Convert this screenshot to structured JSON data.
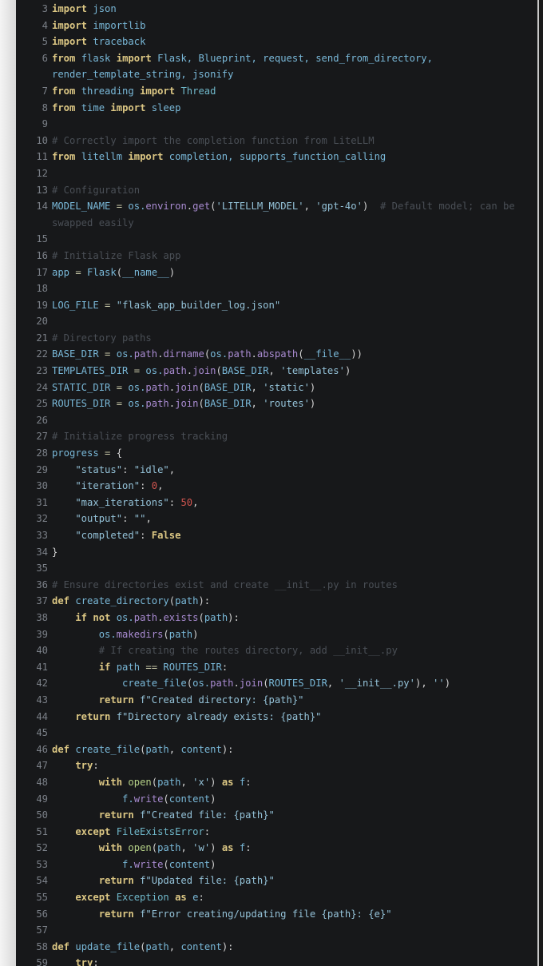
{
  "editor": {
    "language": "python",
    "colors": {
      "background": "#17181a",
      "keyword": "#dcc784",
      "identifier": "#79b8d8",
      "function": "#a98bd1",
      "string": "#94c2d8",
      "number": "#d0554f",
      "comment": "#4a4f56",
      "line_number": "#7b8088"
    },
    "lines": [
      {
        "n": "3",
        "tokens": [
          [
            "kw",
            "import"
          ],
          [
            "id",
            " json"
          ]
        ]
      },
      {
        "n": "4",
        "tokens": [
          [
            "kw",
            "import"
          ],
          [
            "id",
            " importlib"
          ]
        ]
      },
      {
        "n": "5",
        "tokens": [
          [
            "kw",
            "import"
          ],
          [
            "id",
            " traceback"
          ]
        ]
      },
      {
        "n": "6",
        "tokens": [
          [
            "kw",
            "from"
          ],
          [
            "id",
            " flask "
          ],
          [
            "kw",
            "import"
          ],
          [
            "id",
            " Flask, Blueprint, request, send_from_directory,"
          ]
        ]
      },
      {
        "n": "",
        "tokens": [
          [
            "id",
            "render_template_string, jsonify"
          ]
        ]
      },
      {
        "n": "7",
        "tokens": [
          [
            "kw",
            "from"
          ],
          [
            "id",
            " threading "
          ],
          [
            "kw",
            "import"
          ],
          [
            "cls",
            " Thread"
          ]
        ]
      },
      {
        "n": "8",
        "tokens": [
          [
            "kw",
            "from"
          ],
          [
            "id",
            " time "
          ],
          [
            "kw",
            "import"
          ],
          [
            "id",
            " sleep"
          ]
        ]
      },
      {
        "n": "9",
        "tokens": []
      },
      {
        "n": "10",
        "tokens": [
          [
            "cm",
            "# Correctly import the completion function from LiteLLM"
          ]
        ]
      },
      {
        "n": "11",
        "tokens": [
          [
            "kw",
            "from"
          ],
          [
            "id",
            " litellm "
          ],
          [
            "kw",
            "import"
          ],
          [
            "id",
            " completion, supports_function_calling"
          ]
        ]
      },
      {
        "n": "12",
        "tokens": []
      },
      {
        "n": "13",
        "tokens": [
          [
            "cm",
            "# Configuration"
          ]
        ]
      },
      {
        "n": "14",
        "tokens": [
          [
            "id",
            "MODEL_NAME "
          ],
          [
            "op",
            "="
          ],
          [
            "id",
            " os."
          ],
          [
            "fn",
            "environ"
          ],
          [
            "pn",
            "."
          ],
          [
            "fn",
            "get"
          ],
          [
            "pn",
            "("
          ],
          [
            "str",
            "'LITELLM_MODEL'"
          ],
          [
            "pn",
            ", "
          ],
          [
            "str",
            "'gpt-4o'"
          ],
          [
            "pn",
            ")"
          ],
          [
            "cm",
            "  # Default model; can be"
          ]
        ]
      },
      {
        "n": "",
        "tokens": [
          [
            "cm",
            "swapped easily"
          ]
        ]
      },
      {
        "n": "15",
        "tokens": []
      },
      {
        "n": "16",
        "tokens": [
          [
            "cm",
            "# Initialize Flask app"
          ]
        ]
      },
      {
        "n": "17",
        "tokens": [
          [
            "id",
            "app "
          ],
          [
            "op",
            "="
          ],
          [
            "id",
            " Flask"
          ],
          [
            "pn",
            "("
          ],
          [
            "id",
            "__name__"
          ],
          [
            "pn",
            ")"
          ]
        ]
      },
      {
        "n": "18",
        "tokens": []
      },
      {
        "n": "19",
        "tokens": [
          [
            "id",
            "LOG_FILE "
          ],
          [
            "op",
            "="
          ],
          [
            "str",
            " \"flask_app_builder_log.json\""
          ]
        ]
      },
      {
        "n": "20",
        "tokens": []
      },
      {
        "n": "21",
        "tokens": [
          [
            "cm",
            "# Directory paths"
          ]
        ]
      },
      {
        "n": "22",
        "tokens": [
          [
            "id",
            "BASE_DIR "
          ],
          [
            "op",
            "="
          ],
          [
            "id",
            " os."
          ],
          [
            "fn",
            "path"
          ],
          [
            "pn",
            "."
          ],
          [
            "fn",
            "dirname"
          ],
          [
            "pn",
            "("
          ],
          [
            "id",
            "os."
          ],
          [
            "fn",
            "path"
          ],
          [
            "pn",
            "."
          ],
          [
            "fn",
            "abspath"
          ],
          [
            "pn",
            "("
          ],
          [
            "id",
            "__file__"
          ],
          [
            "pn",
            "))"
          ]
        ]
      },
      {
        "n": "23",
        "tokens": [
          [
            "id",
            "TEMPLATES_DIR "
          ],
          [
            "op",
            "="
          ],
          [
            "id",
            " os."
          ],
          [
            "fn",
            "path"
          ],
          [
            "pn",
            "."
          ],
          [
            "fn",
            "join"
          ],
          [
            "pn",
            "("
          ],
          [
            "id",
            "BASE_DIR"
          ],
          [
            "pn",
            ", "
          ],
          [
            "str",
            "'templates'"
          ],
          [
            "pn",
            ")"
          ]
        ]
      },
      {
        "n": "24",
        "tokens": [
          [
            "id",
            "STATIC_DIR "
          ],
          [
            "op",
            "="
          ],
          [
            "id",
            " os."
          ],
          [
            "fn",
            "path"
          ],
          [
            "pn",
            "."
          ],
          [
            "fn",
            "join"
          ],
          [
            "pn",
            "("
          ],
          [
            "id",
            "BASE_DIR"
          ],
          [
            "pn",
            ", "
          ],
          [
            "str",
            "'static'"
          ],
          [
            "pn",
            ")"
          ]
        ]
      },
      {
        "n": "25",
        "tokens": [
          [
            "id",
            "ROUTES_DIR "
          ],
          [
            "op",
            "="
          ],
          [
            "id",
            " os."
          ],
          [
            "fn",
            "path"
          ],
          [
            "pn",
            "."
          ],
          [
            "fn",
            "join"
          ],
          [
            "pn",
            "("
          ],
          [
            "id",
            "BASE_DIR"
          ],
          [
            "pn",
            ", "
          ],
          [
            "str",
            "'routes'"
          ],
          [
            "pn",
            ")"
          ]
        ]
      },
      {
        "n": "26",
        "tokens": []
      },
      {
        "n": "27",
        "tokens": [
          [
            "cm",
            "# Initialize progress tracking"
          ]
        ]
      },
      {
        "n": "28",
        "tokens": [
          [
            "id",
            "progress "
          ],
          [
            "op",
            "="
          ],
          [
            "pn",
            " {"
          ]
        ]
      },
      {
        "n": "29",
        "tokens": [
          [
            "str",
            "    \"status\""
          ],
          [
            "pn",
            ": "
          ],
          [
            "str",
            "\"idle\""
          ],
          [
            "pn",
            ","
          ]
        ]
      },
      {
        "n": "30",
        "tokens": [
          [
            "str",
            "    \"iteration\""
          ],
          [
            "pn",
            ": "
          ],
          [
            "num",
            "0"
          ],
          [
            "pn",
            ","
          ]
        ]
      },
      {
        "n": "31",
        "tokens": [
          [
            "str",
            "    \"max_iterations\""
          ],
          [
            "pn",
            ": "
          ],
          [
            "num",
            "50"
          ],
          [
            "pn",
            ","
          ]
        ]
      },
      {
        "n": "32",
        "tokens": [
          [
            "str",
            "    \"output\""
          ],
          [
            "pn",
            ": "
          ],
          [
            "str",
            "\"\""
          ],
          [
            "pn",
            ","
          ]
        ]
      },
      {
        "n": "33",
        "tokens": [
          [
            "str",
            "    \"completed\""
          ],
          [
            "pn",
            ": "
          ],
          [
            "kw",
            "False"
          ]
        ]
      },
      {
        "n": "34",
        "tokens": [
          [
            "pn",
            "}"
          ]
        ]
      },
      {
        "n": "35",
        "tokens": []
      },
      {
        "n": "36",
        "tokens": [
          [
            "cm",
            "# Ensure directories exist and create __init__.py in routes"
          ]
        ]
      },
      {
        "n": "37",
        "tokens": [
          [
            "kw",
            "def"
          ],
          [
            "id",
            " create_directory"
          ],
          [
            "pn",
            "("
          ],
          [
            "id",
            "path"
          ],
          [
            "pn",
            "):"
          ]
        ]
      },
      {
        "n": "38",
        "tokens": [
          [
            "kw",
            "    if not"
          ],
          [
            "id",
            " os."
          ],
          [
            "fn",
            "path"
          ],
          [
            "pn",
            "."
          ],
          [
            "fn",
            "exists"
          ],
          [
            "pn",
            "("
          ],
          [
            "id",
            "path"
          ],
          [
            "pn",
            "):"
          ]
        ]
      },
      {
        "n": "39",
        "tokens": [
          [
            "id",
            "        os."
          ],
          [
            "fn",
            "makedirs"
          ],
          [
            "pn",
            "("
          ],
          [
            "id",
            "path"
          ],
          [
            "pn",
            ")"
          ]
        ]
      },
      {
        "n": "40",
        "tokens": [
          [
            "cm",
            "        # If creating the routes directory, add __init__.py"
          ]
        ]
      },
      {
        "n": "41",
        "tokens": [
          [
            "kw",
            "        if"
          ],
          [
            "id",
            " path "
          ],
          [
            "op",
            "=="
          ],
          [
            "id",
            " ROUTES_DIR"
          ],
          [
            "pn",
            ":"
          ]
        ]
      },
      {
        "n": "42",
        "tokens": [
          [
            "id",
            "            create_file"
          ],
          [
            "pn",
            "("
          ],
          [
            "id",
            "os."
          ],
          [
            "fn",
            "path"
          ],
          [
            "pn",
            "."
          ],
          [
            "fn",
            "join"
          ],
          [
            "pn",
            "("
          ],
          [
            "id",
            "ROUTES_DIR"
          ],
          [
            "pn",
            ", "
          ],
          [
            "str",
            "'__init__.py'"
          ],
          [
            "pn",
            "), "
          ],
          [
            "str",
            "''"
          ],
          [
            "pn",
            ")"
          ]
        ]
      },
      {
        "n": "43",
        "tokens": [
          [
            "kw",
            "        return"
          ],
          [
            "str",
            " f\"Created directory: {path}\""
          ]
        ]
      },
      {
        "n": "44",
        "tokens": [
          [
            "kw",
            "    return"
          ],
          [
            "str",
            " f\"Directory already exists: {path}\""
          ]
        ]
      },
      {
        "n": "45",
        "tokens": []
      },
      {
        "n": "46",
        "tokens": [
          [
            "kw",
            "def"
          ],
          [
            "id",
            " create_file"
          ],
          [
            "pn",
            "("
          ],
          [
            "id",
            "path"
          ],
          [
            "pn",
            ", "
          ],
          [
            "id",
            "content"
          ],
          [
            "pn",
            "):"
          ]
        ]
      },
      {
        "n": "47",
        "tokens": [
          [
            "kw",
            "    try"
          ],
          [
            "pn",
            ":"
          ]
        ]
      },
      {
        "n": "48",
        "tokens": [
          [
            "kw",
            "        with"
          ],
          [
            "bi",
            " open"
          ],
          [
            "pn",
            "("
          ],
          [
            "id",
            "path"
          ],
          [
            "pn",
            ", "
          ],
          [
            "str",
            "'x'"
          ],
          [
            "pn",
            ") "
          ],
          [
            "kw",
            "as"
          ],
          [
            "id",
            " f"
          ],
          [
            "pn",
            ":"
          ]
        ]
      },
      {
        "n": "49",
        "tokens": [
          [
            "id",
            "            f."
          ],
          [
            "fn",
            "write"
          ],
          [
            "pn",
            "("
          ],
          [
            "id",
            "content"
          ],
          [
            "pn",
            ")"
          ]
        ]
      },
      {
        "n": "50",
        "tokens": [
          [
            "kw",
            "        return"
          ],
          [
            "str",
            " f\"Created file: {path}\""
          ]
        ]
      },
      {
        "n": "51",
        "tokens": [
          [
            "kw",
            "    except"
          ],
          [
            "cls",
            " FileExistsError"
          ],
          [
            "pn",
            ":"
          ]
        ]
      },
      {
        "n": "52",
        "tokens": [
          [
            "kw",
            "        with"
          ],
          [
            "bi",
            " open"
          ],
          [
            "pn",
            "("
          ],
          [
            "id",
            "path"
          ],
          [
            "pn",
            ", "
          ],
          [
            "str",
            "'w'"
          ],
          [
            "pn",
            ") "
          ],
          [
            "kw",
            "as"
          ],
          [
            "id",
            " f"
          ],
          [
            "pn",
            ":"
          ]
        ]
      },
      {
        "n": "53",
        "tokens": [
          [
            "id",
            "            f."
          ],
          [
            "fn",
            "write"
          ],
          [
            "pn",
            "("
          ],
          [
            "id",
            "content"
          ],
          [
            "pn",
            ")"
          ]
        ]
      },
      {
        "n": "54",
        "tokens": [
          [
            "kw",
            "        return"
          ],
          [
            "str",
            " f\"Updated file: {path}\""
          ]
        ]
      },
      {
        "n": "55",
        "tokens": [
          [
            "kw",
            "    except"
          ],
          [
            "cls",
            " Exception "
          ],
          [
            "kw",
            "as"
          ],
          [
            "id",
            " e"
          ],
          [
            "pn",
            ":"
          ]
        ]
      },
      {
        "n": "56",
        "tokens": [
          [
            "kw",
            "        return"
          ],
          [
            "str",
            " f\"Error creating/updating file {path}: {e}\""
          ]
        ]
      },
      {
        "n": "57",
        "tokens": []
      },
      {
        "n": "58",
        "tokens": [
          [
            "kw",
            "def"
          ],
          [
            "id",
            " update_file"
          ],
          [
            "pn",
            "("
          ],
          [
            "id",
            "path"
          ],
          [
            "pn",
            ", "
          ],
          [
            "id",
            "content"
          ],
          [
            "pn",
            "):"
          ]
        ]
      },
      {
        "n": "59",
        "tokens": [
          [
            "kw",
            "    try"
          ],
          [
            "pn",
            ":"
          ]
        ]
      }
    ]
  }
}
